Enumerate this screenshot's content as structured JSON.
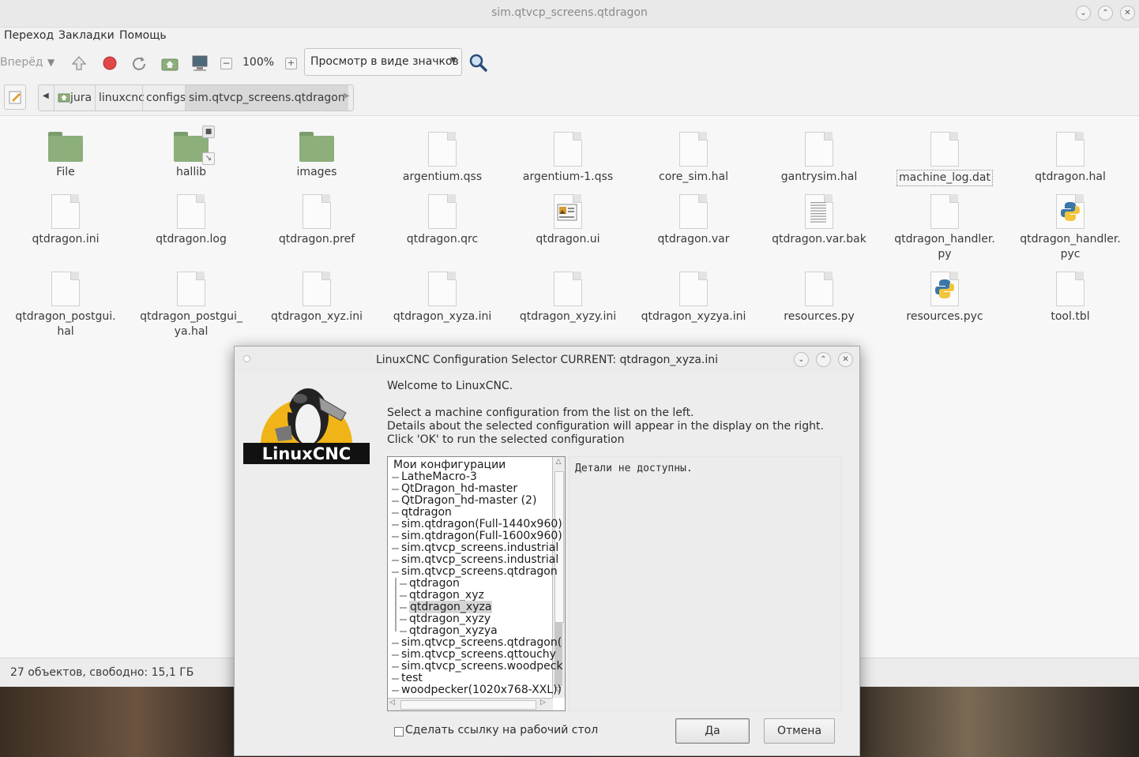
{
  "window": {
    "title": "sim.qtvcp_screens.qtdragon",
    "controls": [
      "⌄",
      "⌃",
      "✕"
    ]
  },
  "menubar": [
    "Переход",
    "Закладки",
    "Помощь"
  ],
  "toolbar": {
    "forward_label": "Вперёд",
    "zoom": "100%",
    "view_mode": "Просмотр в виде значков"
  },
  "breadcrumb": [
    "jura",
    "linuxcnc",
    "configs",
    "sim.qtvcp_screens.qtdragon"
  ],
  "files": [
    {
      "name": "File",
      "type": "folder"
    },
    {
      "name": "hallib",
      "type": "folder-link"
    },
    {
      "name": "images",
      "type": "folder"
    },
    {
      "name": "argentium.qss",
      "type": "doc"
    },
    {
      "name": "argentium-1.qss",
      "type": "doc"
    },
    {
      "name": "core_sim.hal",
      "type": "doc"
    },
    {
      "name": "gantrysim.hal",
      "type": "doc"
    },
    {
      "name": "machine_log.dat",
      "type": "doc"
    },
    {
      "name": "qtdragon.hal",
      "type": "doc"
    },
    {
      "name": "qtdragon.ini",
      "type": "doc"
    },
    {
      "name": "qtdragon.log",
      "type": "doc"
    },
    {
      "name": "qtdragon.pref",
      "type": "doc"
    },
    {
      "name": "qtdragon.qrc",
      "type": "doc"
    },
    {
      "name": "qtdragon.ui",
      "type": "ui"
    },
    {
      "name": "qtdragon.var",
      "type": "doc"
    },
    {
      "name": "qtdragon.var.bak",
      "type": "text"
    },
    {
      "name": "qtdragon_handler.\npy",
      "type": "doc"
    },
    {
      "name": "qtdragon_handler.\npyc",
      "type": "python"
    },
    {
      "name": "qtdragon_postgui.\nhal",
      "type": "doc"
    },
    {
      "name": "qtdragon_postgui_\nya.hal",
      "type": "doc"
    },
    {
      "name": "qtdragon_xyz.ini",
      "type": "doc"
    },
    {
      "name": "qtdragon_xyza.ini",
      "type": "doc"
    },
    {
      "name": "qtdragon_xyzy.ini",
      "type": "doc"
    },
    {
      "name": "qtdragon_xyzya.ini",
      "type": "doc"
    },
    {
      "name": "resources.py",
      "type": "doc"
    },
    {
      "name": "resources.pyc",
      "type": "python"
    },
    {
      "name": "tool.tbl",
      "type": "doc"
    }
  ],
  "status": "27 объектов, свободно: 15,1 ГБ",
  "dialog": {
    "title": "LinuxCNC Configuration Selector CURRENT: qtdragon_xyza.ini",
    "logo_text": "LinuxCNC",
    "welcome": "Welcome to LinuxCNC.",
    "instructions": [
      "Select a machine configuration from the list on the left.",
      "Details about the selected configuration will appear in the display on the right.",
      "Click 'OK' to run the selected configuration"
    ],
    "tree": [
      {
        "label": "Мои конфигурации",
        "level": 0
      },
      {
        "label": "LatheMacro-3",
        "level": 1
      },
      {
        "label": "QtDragon_hd-master",
        "level": 1
      },
      {
        "label": "QtDragon_hd-master (2)",
        "level": 1
      },
      {
        "label": "qtdragon",
        "level": 1
      },
      {
        "label": "sim.qtdragon(Full-1440x960)",
        "level": 1
      },
      {
        "label": "sim.qtdragon(Full-1600x960)",
        "level": 1
      },
      {
        "label": "sim.qtvcp_screens.industrial",
        "level": 1
      },
      {
        "label": "sim.qtvcp_screens.industrial",
        "level": 1
      },
      {
        "label": "sim.qtvcp_screens.qtdragon",
        "level": 1
      },
      {
        "label": "qtdragon",
        "level": 2
      },
      {
        "label": "qtdragon_xyz",
        "level": 2
      },
      {
        "label": "qtdragon_xyza",
        "level": 2,
        "selected": true
      },
      {
        "label": "qtdragon_xyzy",
        "level": 2
      },
      {
        "label": "qtdragon_xyzya",
        "level": 2
      },
      {
        "label": "sim.qtvcp_screens.qtdragon(",
        "level": 1
      },
      {
        "label": "sim.qtvcp_screens.qttouchy",
        "level": 1
      },
      {
        "label": "sim.qtvcp_screens.woodpeck",
        "level": 1
      },
      {
        "label": "test",
        "level": 1
      },
      {
        "label": "woodpecker(1020x768-XXL))",
        "level": 1
      }
    ],
    "details": "Детали не доступны.",
    "desktop_link": "Сделать ссылку на рабочий стол",
    "ok_label": "Да",
    "cancel_label": "Отмена"
  }
}
